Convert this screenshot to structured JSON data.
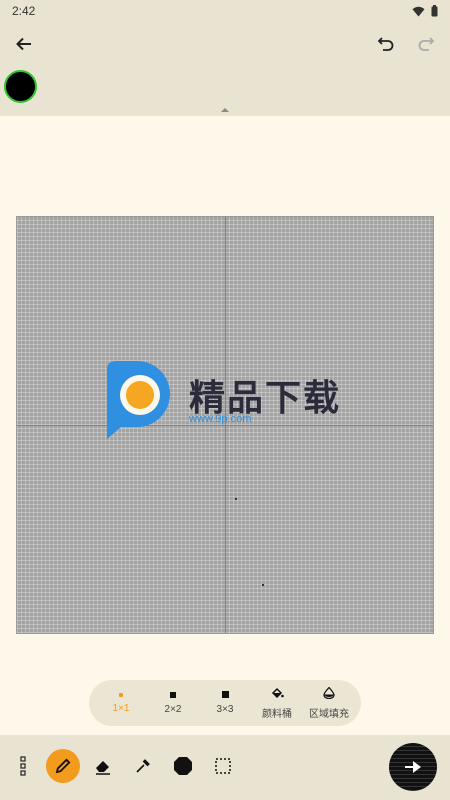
{
  "status_bar": {
    "time": "2:42",
    "wifi_icon": "wifi-icon",
    "battery_icon": "battery-icon"
  },
  "app_bar": {
    "back_icon": "arrow-back-icon",
    "undo_icon": "undo-icon",
    "redo_icon": "redo-icon"
  },
  "current_color": {
    "value": "#000000",
    "ring": "#32c132"
  },
  "canvas": {
    "guide_color": "#3db34a",
    "grid_background": "#a3a3a3"
  },
  "watermark": {
    "title": "精品下载",
    "url": "www.9p.com"
  },
  "brush_sizes": [
    {
      "label": "1×1",
      "active": true
    },
    {
      "label": "2×2",
      "active": false
    },
    {
      "label": "3×3",
      "active": false
    },
    {
      "label": "颜料桶",
      "active": false,
      "icon": "paint-bucket-icon"
    },
    {
      "label": "区域填充",
      "active": false,
      "icon": "area-fill-icon"
    }
  ],
  "tools": [
    {
      "name": "more-menu-icon"
    },
    {
      "name": "pencil-icon",
      "active": true
    },
    {
      "name": "eraser-icon"
    },
    {
      "name": "eyedropper-icon"
    },
    {
      "name": "stamp-icon"
    },
    {
      "name": "selection-icon"
    }
  ],
  "accent": "#f29b1d",
  "fab_icon": "forward-arrow-icon"
}
